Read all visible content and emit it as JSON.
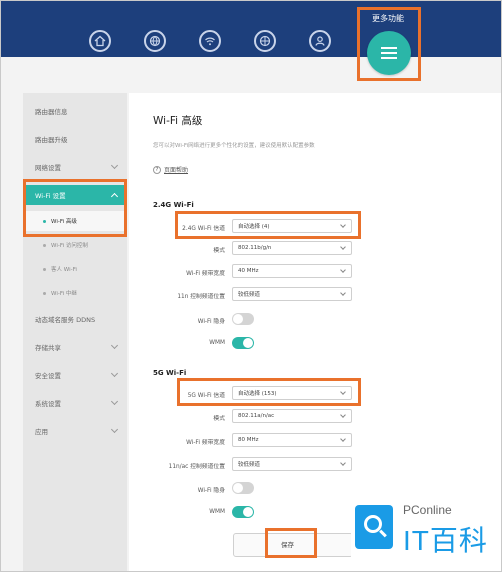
{
  "header": {
    "nav_icons": [
      "home-icon",
      "globe-icon",
      "wifi-icon",
      "network-globe-icon",
      "user-icon"
    ],
    "more_label": "更多功能",
    "more_icon": "menu-icon",
    "bar_color": "#1d3f7c",
    "accent_color": "#2bb6a8",
    "highlight_color": "#e9712c"
  },
  "sidebar": {
    "items": [
      {
        "label": "路由器信息"
      },
      {
        "label": "路由器升级"
      },
      {
        "label": "网络设置"
      },
      {
        "label": "Wi-Fi 设置"
      },
      {
        "label": "动态域名服务 DDNS"
      },
      {
        "label": "存储共享"
      },
      {
        "label": "安全设置"
      },
      {
        "label": "系统设置"
      },
      {
        "label": "应用"
      }
    ],
    "subitems": [
      {
        "label": "Wi-Fi 高级"
      },
      {
        "label": "Wi-Fi 访问控制"
      },
      {
        "label": "客人 Wi-Fi"
      },
      {
        "label": "Wi-Fi 中继"
      }
    ]
  },
  "main": {
    "title": "Wi-Fi 高级",
    "description": "您可以对Wi-Fi网络进行更多个性化的设置，建议使用默认配置参数",
    "help_link": "页面帮助",
    "band24": {
      "heading": "2.4G Wi-Fi",
      "channel_label": "2.4G Wi-Fi 信道",
      "channel_value": "自动选择 (4)",
      "mode_label": "模式",
      "mode_value": "802.11b/g/n",
      "bandwidth_label": "Wi-Fi 频带宽度",
      "bandwidth_value": "40 MHz",
      "sideband_label": "11n 控制频道位置",
      "sideband_value": "较低频道",
      "hidden_label": "Wi-Fi 隐身",
      "wmm_label": "WMM"
    },
    "band5": {
      "heading": "5G Wi-Fi",
      "channel_label": "5G Wi-Fi 信道",
      "channel_value": "自动选择 (153)",
      "mode_label": "模式",
      "mode_value": "802.11a/n/ac",
      "bandwidth_label": "Wi-Fi 频带宽度",
      "bandwidth_value": "80 MHz",
      "sideband_label": "11n/ac 控制频道位置",
      "sideband_value": "较低频道",
      "hidden_label": "Wi-Fi 隐身",
      "wmm_label": "WMM"
    },
    "save_label": "保存"
  },
  "watermark": {
    "brand_top": "PConline",
    "brand_main": "IT百科",
    "logo_icon": "magnifier-icon"
  }
}
